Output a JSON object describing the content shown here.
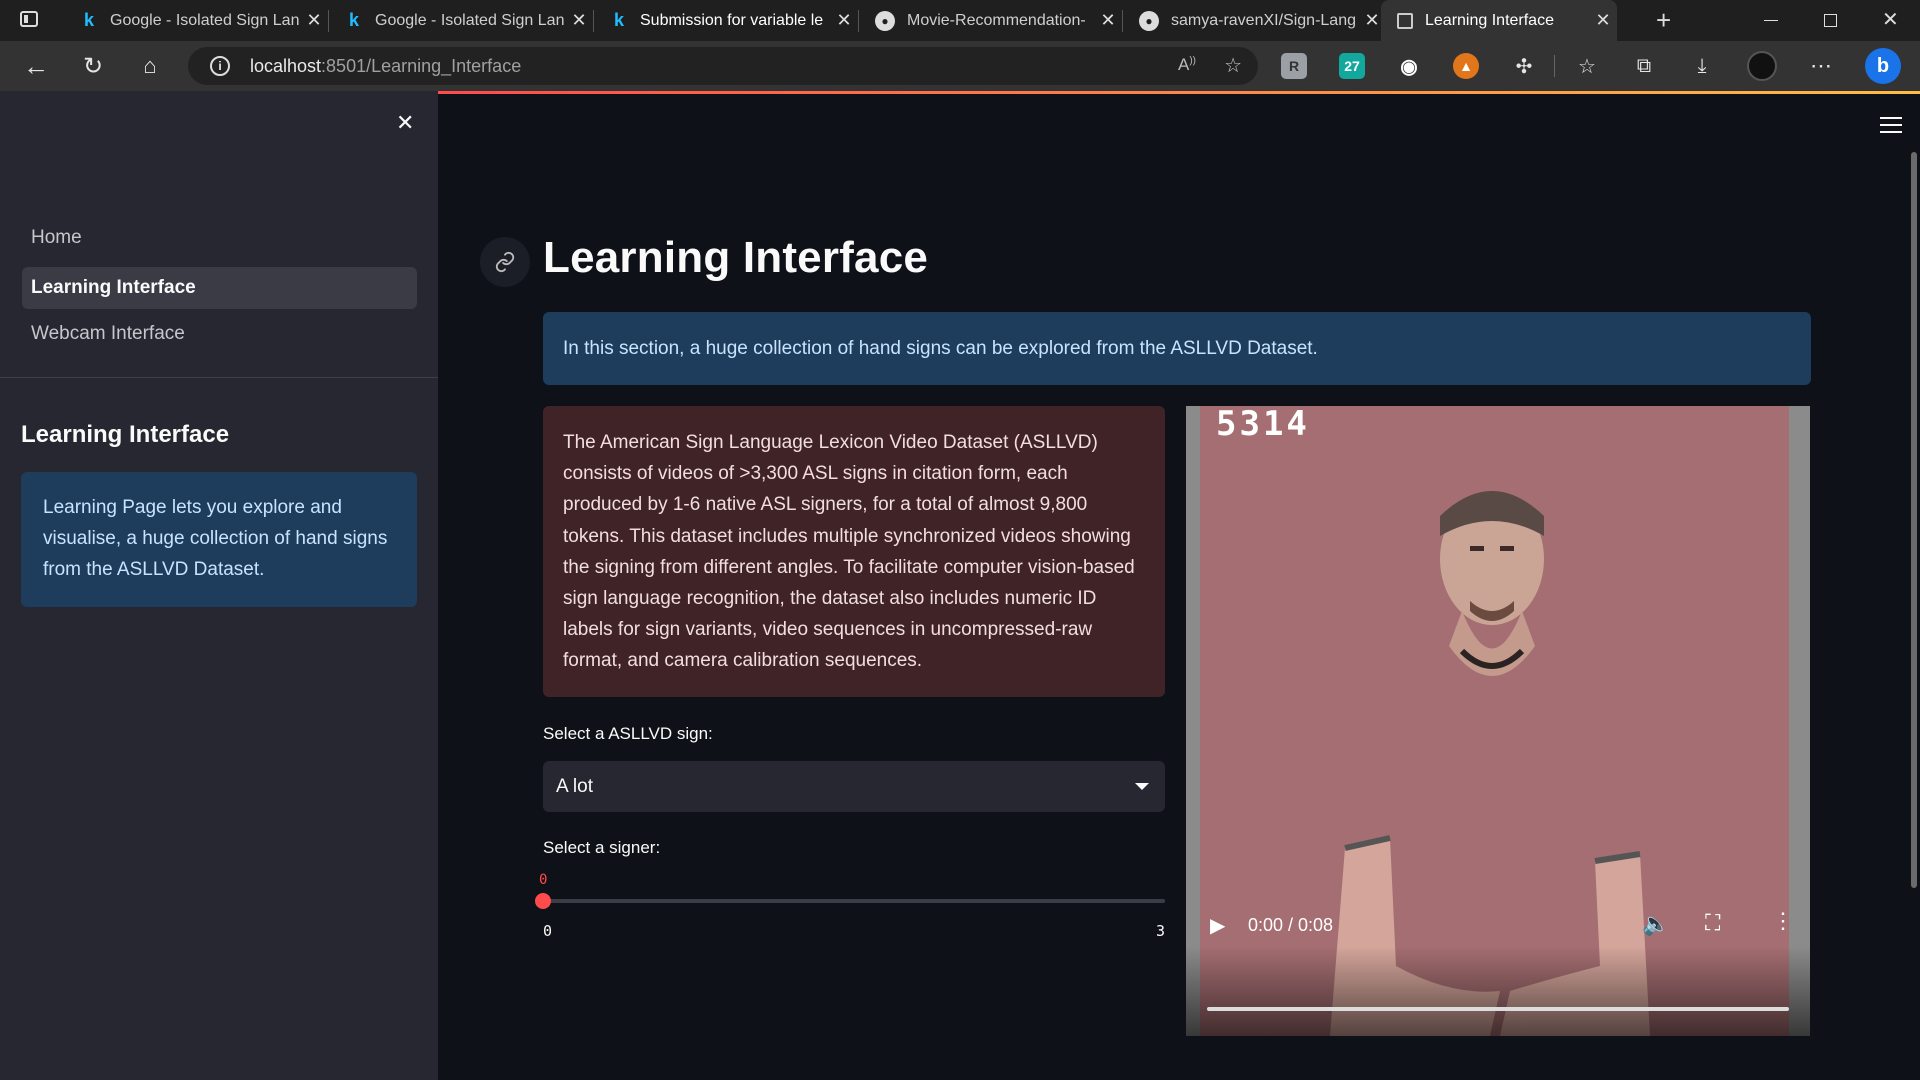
{
  "browser": {
    "tabs": [
      {
        "label": "Google - Isolated Sign Lan",
        "favicon": "kaggle-icon",
        "active": false
      },
      {
        "label": "Google - Isolated Sign Lan",
        "favicon": "kaggle-icon",
        "active": false
      },
      {
        "label": "Submission for variable le",
        "favicon": "kaggle-icon",
        "active": false
      },
      {
        "label": "Movie-Recommendation-",
        "favicon": "github-icon",
        "active": false
      },
      {
        "label": "samya-ravenXI/Sign-Lang",
        "favicon": "github-icon",
        "active": false
      },
      {
        "label": "Learning Interface",
        "favicon": "streamlit-icon",
        "active": true
      }
    ],
    "url_host": "localhost",
    "url_rest": ":8501/Learning_Interface",
    "extension_badge": "27"
  },
  "sidebar": {
    "nav": [
      {
        "label": "Home",
        "active": false
      },
      {
        "label": "Learning Interface",
        "active": true
      },
      {
        "label": "Webcam Interface",
        "active": false
      }
    ],
    "title": "Learning Interface",
    "info": "Learning Page lets you explore and visualise, a huge collection of hand signs from the ASLLVD Dataset."
  },
  "main": {
    "title": "Learning Interface",
    "banner": "In this section, a huge collection of hand signs can be explored from the ASLLVD Dataset.",
    "description": "The American Sign Language Lexicon Video Dataset (ASLLVD) consists of videos of >3,300 ASL signs in citation form, each produced by 1-6 native ASL signers, for a total of almost 9,800 tokens. This dataset includes multiple synchronized videos showing the signing from different angles. To facilitate computer vision-based sign language recognition, the dataset also includes numeric ID labels for sign variants, video sequences in uncompressed-raw format, and camera calibration sequences.",
    "sign_select_label": "Select a ASLLVD sign:",
    "sign_selected": "A lot",
    "signer_label": "Select a signer:",
    "signer_value": "0",
    "signer_min": "0",
    "signer_max": "3"
  },
  "video": {
    "frame_number": "5314",
    "time": "0:00 / 0:08"
  },
  "colors": {
    "accent": "#ff4b4b",
    "info_bg": "#1e3c5c",
    "error_bg": "#3f2327",
    "sidebar_bg": "#262730",
    "app_bg": "#0e1117"
  }
}
